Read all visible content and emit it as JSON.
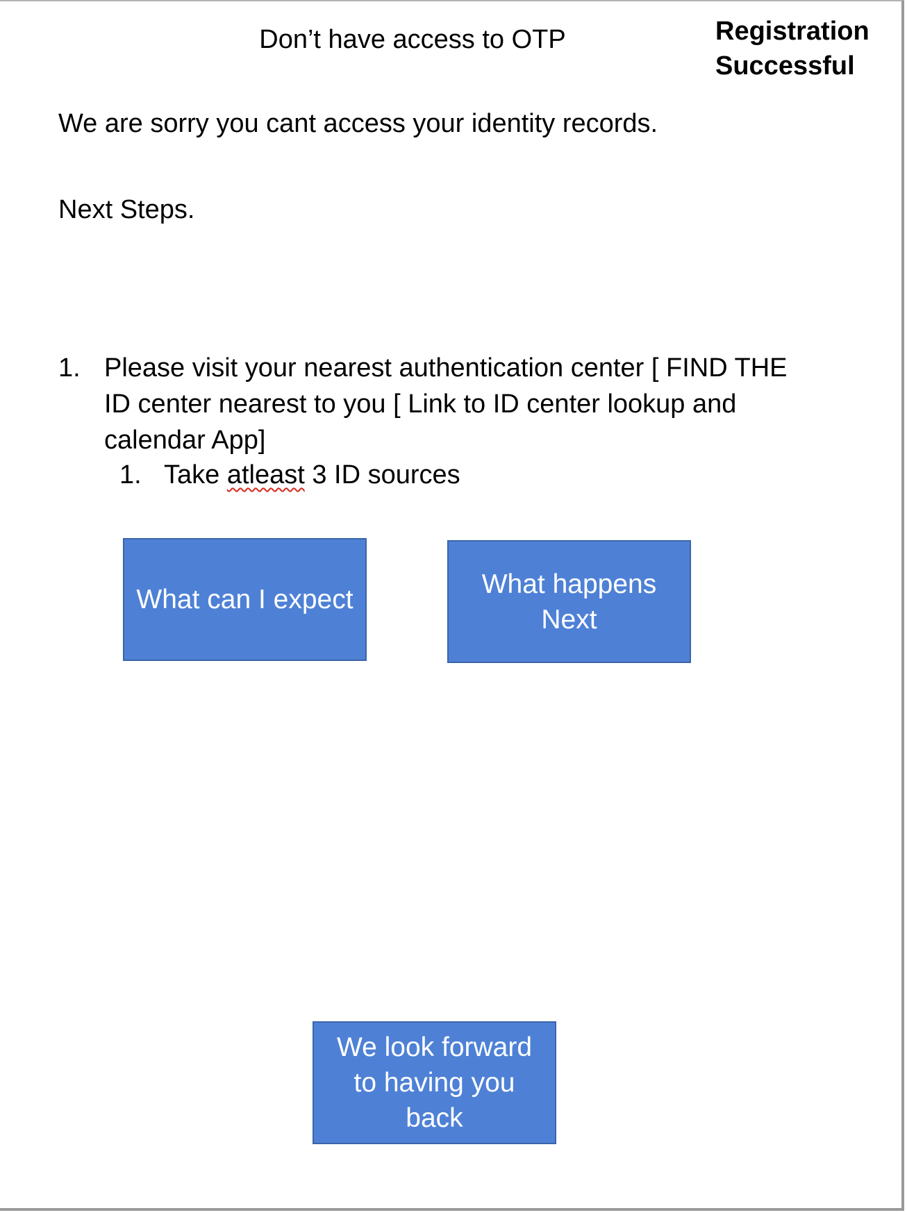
{
  "header": {
    "title": "Don’t have access to OTP",
    "status": "Registration Successful"
  },
  "body": {
    "apology": "We are sorry you cant access your identity records.",
    "next_steps_heading": "Next Steps."
  },
  "steps": {
    "item_number": "1.",
    "item_text": "Please visit your nearest authentication center [ FIND THE ID center nearest to you [ Link to ID center lookup and calendar App]",
    "sub_item_number": "1.",
    "sub_item_before": "Take ",
    "sub_item_flagged_word": "atleast",
    "sub_item_after": " 3 ID sources"
  },
  "buttons": {
    "expect_label": "What can I expect",
    "next_label": "What happens Next",
    "back_label": "We look forward to having you back"
  },
  "colors": {
    "button_fill": "#4e81d6",
    "button_border": "#3a64a8",
    "spellcheck_underline": "#d8281c"
  }
}
